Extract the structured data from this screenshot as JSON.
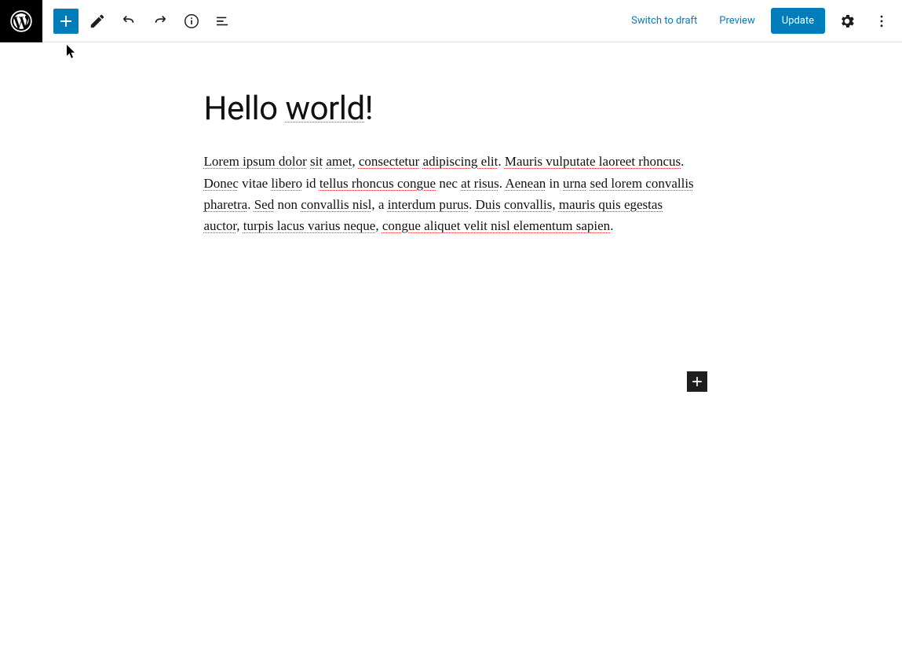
{
  "header": {
    "switch_to_draft": "Switch to draft",
    "preview": "Preview",
    "update": "Update"
  },
  "post": {
    "title_prefix": "Hello ",
    "title_spell": "world",
    "title_suffix": "!",
    "body_segments": [
      {
        "t": "Lorem ipsum dolor",
        "s": true
      },
      {
        "t": " ",
        "s": false
      },
      {
        "t": "sit",
        "s": true
      },
      {
        "t": " ",
        "s": false
      },
      {
        "t": "amet",
        "s": true
      },
      {
        "t": ", ",
        "s": false
      },
      {
        "t": "consectetur",
        "s": true
      },
      {
        "t": " ",
        "s": false
      },
      {
        "t": "adipiscing elit",
        "s": true
      },
      {
        "t": ". ",
        "s": false
      },
      {
        "t": "Mauris vulputate laoreet rhoncus",
        "s": true
      },
      {
        "t": ". ",
        "s": false
      },
      {
        "t": "Donec",
        "s": true
      },
      {
        "t": " vitae ",
        "s": false
      },
      {
        "t": "libero",
        "s": true
      },
      {
        "t": " id ",
        "s": false
      },
      {
        "t": "tellus rhoncus congue",
        "s": true
      },
      {
        "t": " nec ",
        "s": false
      },
      {
        "t": "at risus",
        "s": true
      },
      {
        "t": ". ",
        "s": false
      },
      {
        "t": "Aenean",
        "s": true
      },
      {
        "t": " in ",
        "s": false
      },
      {
        "t": "urna",
        "s": true
      },
      {
        "t": " ",
        "s": false
      },
      {
        "t": "sed lorem convallis pharetra",
        "s": true
      },
      {
        "t": ". ",
        "s": false
      },
      {
        "t": "Sed",
        "s": true
      },
      {
        "t": " non ",
        "s": false
      },
      {
        "t": "convallis nisl",
        "s": true
      },
      {
        "t": ", a ",
        "s": false
      },
      {
        "t": "interdum purus",
        "s": true
      },
      {
        "t": ". ",
        "s": false
      },
      {
        "t": "Duis",
        "s": true
      },
      {
        "t": " ",
        "s": false
      },
      {
        "t": "convallis",
        "s": true
      },
      {
        "t": ", ",
        "s": false
      },
      {
        "t": "mauris quis egestas auctor",
        "s": true
      },
      {
        "t": ", ",
        "s": false
      },
      {
        "t": "turpis lacus varius neque",
        "s": true
      },
      {
        "t": ", ",
        "s": false
      },
      {
        "t": "congue aliquet velit nisl elementum sapien",
        "s": true
      },
      {
        "t": ".",
        "s": false
      }
    ]
  }
}
